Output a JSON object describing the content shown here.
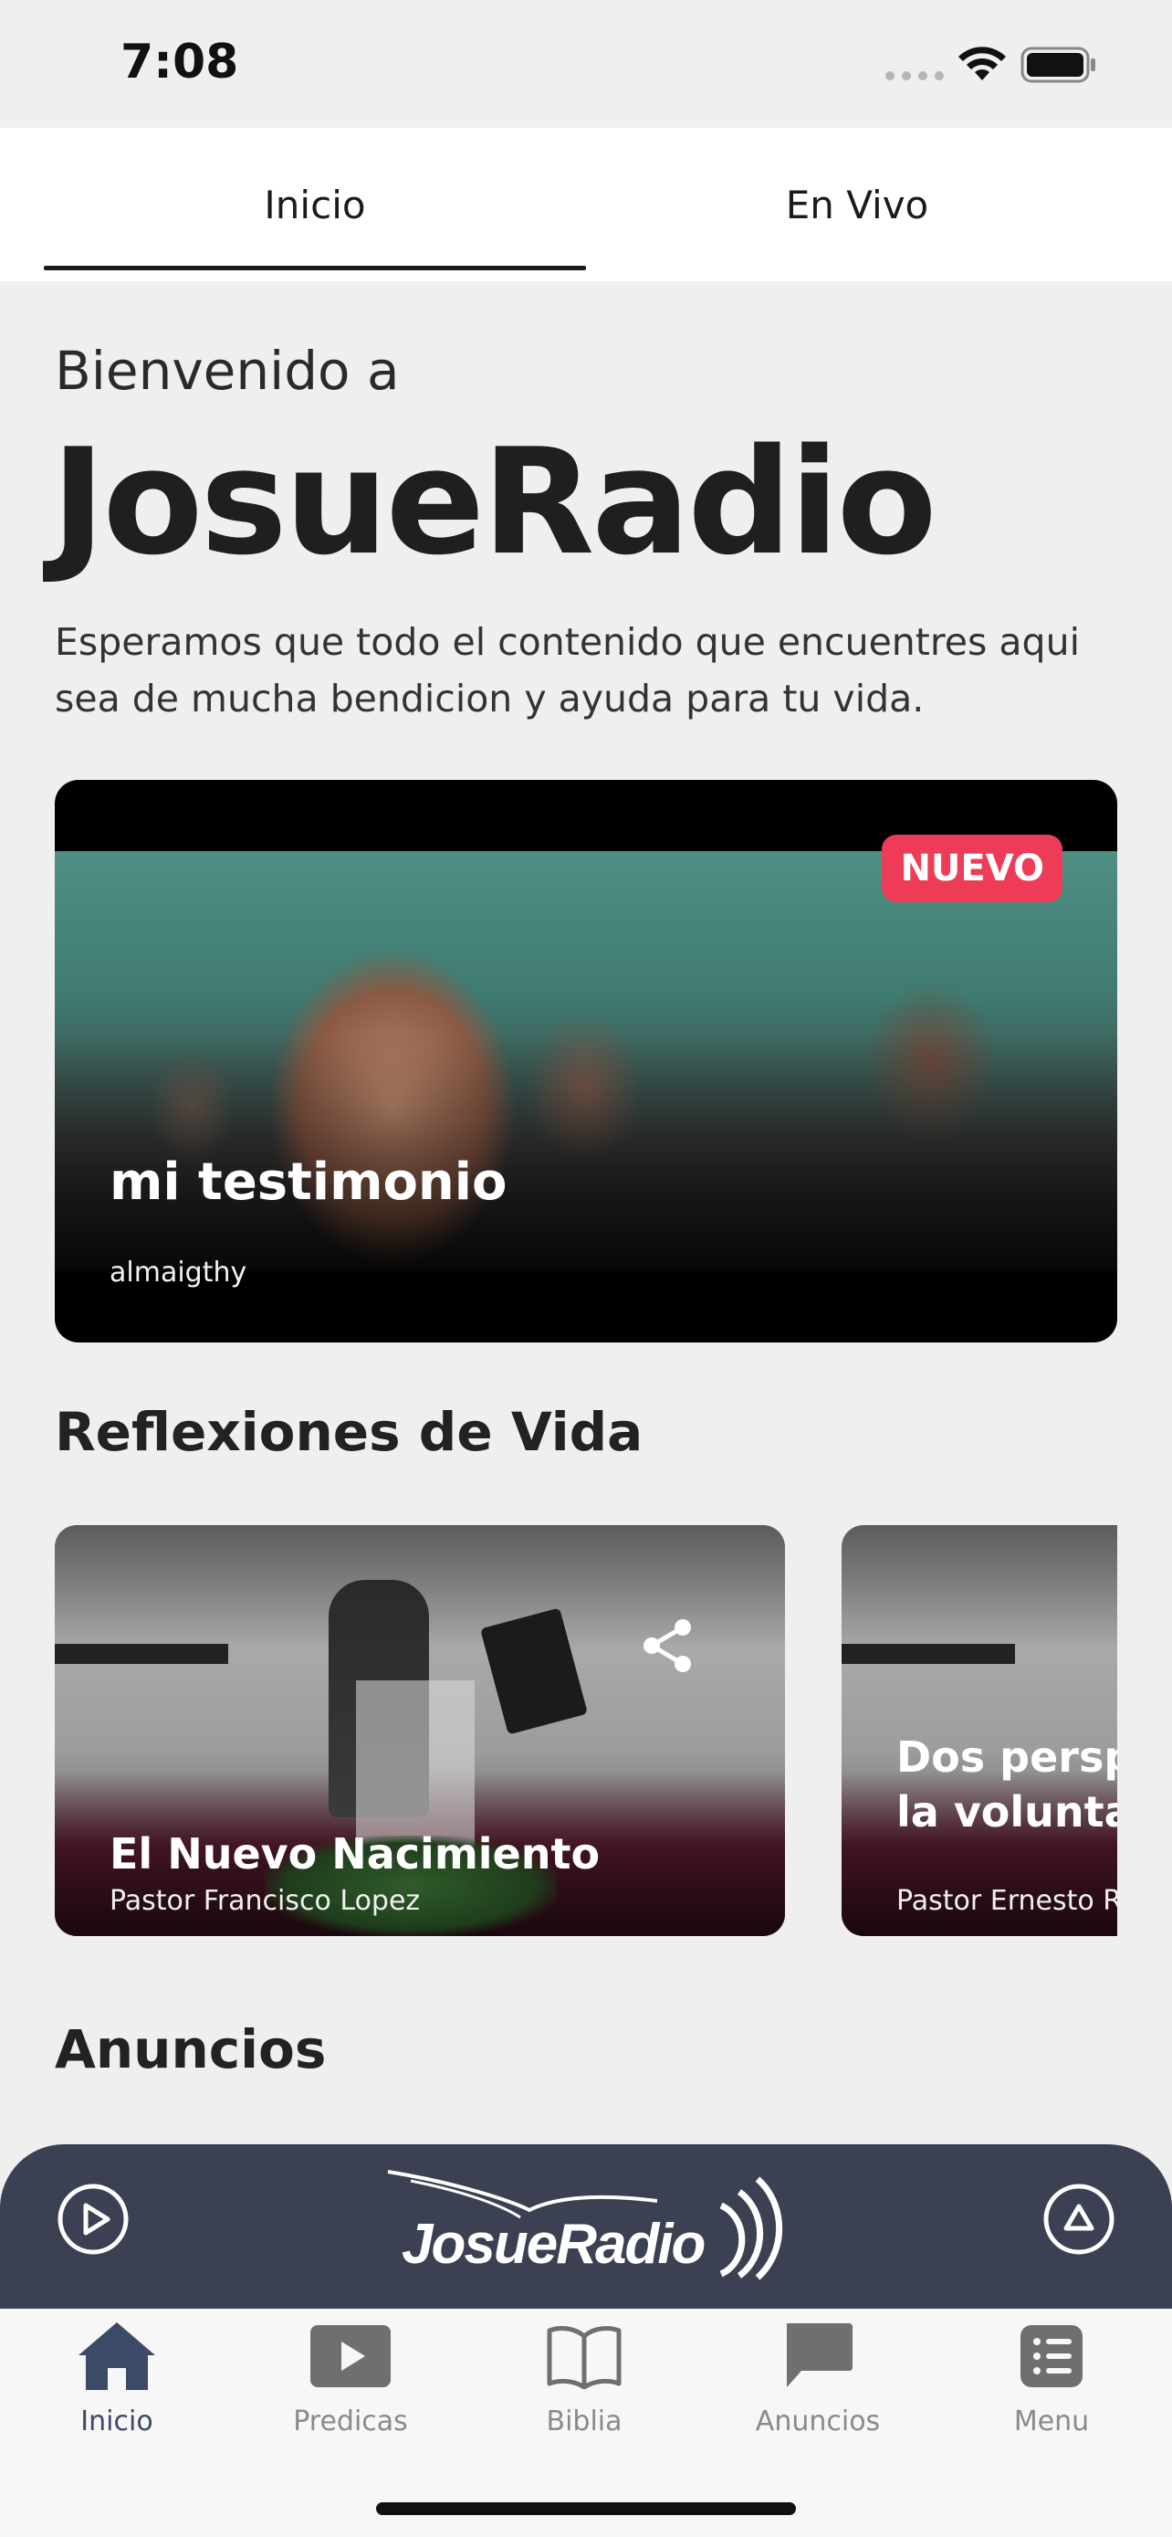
{
  "status": {
    "time": "7:08"
  },
  "tabs": [
    {
      "label": "Inicio"
    },
    {
      "label": "En Vivo"
    }
  ],
  "hero": {
    "welcome": "Bienvenido a",
    "brand": "JosueRadio",
    "intro": "Esperamos que todo el contenido que encuentres aqui sea de mucha bendicion y ayuda para tu vida."
  },
  "featured": {
    "badge": "NUEVO",
    "title": "mi testimonio",
    "author": "almaigthy"
  },
  "reflexiones": {
    "title": "Reflexiones de Vida",
    "cards": [
      {
        "title": "El Nuevo Nacimiento",
        "author": "Pastor Francisco Lopez"
      },
      {
        "title": "Dos perspectivas de la voluntad de Dios",
        "author": "Pastor Ernesto Ro"
      }
    ]
  },
  "anuncios": {
    "title": "Anuncios"
  },
  "player": {
    "logo_text": "JosueRadio"
  },
  "nav": [
    {
      "label": "Inicio",
      "icon": "home-icon"
    },
    {
      "label": "Predicas",
      "icon": "video-icon"
    },
    {
      "label": "Biblia",
      "icon": "book-icon"
    },
    {
      "label": "Anuncios",
      "icon": "chat-icon"
    },
    {
      "label": "Menu",
      "icon": "list-icon"
    }
  ],
  "colors": {
    "accent": "#ee3b57",
    "player_bg": "#3b4052",
    "nav_active": "#3b4a66"
  }
}
